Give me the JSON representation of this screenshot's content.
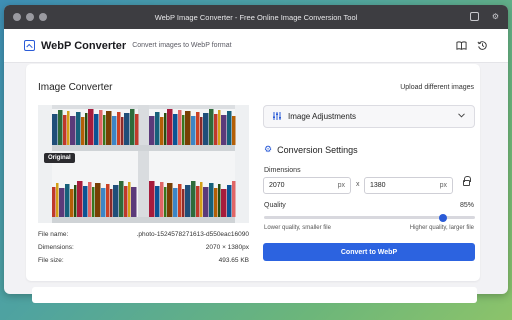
{
  "window": {
    "title": "WebP Image Converter - Free Online Image Conversion Tool"
  },
  "header": {
    "app_name": "WebP Converter",
    "tagline": "Convert images to WebP format",
    "icons": [
      "book-icon",
      "history-icon"
    ]
  },
  "converter": {
    "title": "Image Converter",
    "upload_link": "Upload different images",
    "badge": "Original",
    "file": {
      "name_label": "File name:",
      "name_value": ".photo-1524578271613-d550eac16090",
      "dims_label": "Dimensions:",
      "dims_value": "2070 × 1380px",
      "size_label": "File size:",
      "size_value": "493.65 KB"
    }
  },
  "adjustments": {
    "label": "Image Adjustments"
  },
  "settings": {
    "title": "Conversion Settings",
    "dimensions_label": "Dimensions",
    "width": "2070",
    "height": "1380",
    "unit": "px",
    "times": "x",
    "quality_label": "Quality",
    "quality_value": "85%",
    "quality": 0.85,
    "hint_low": "Lower quality, smaller file",
    "hint_high": "Higher quality, larger file",
    "convert_label": "Convert to WebP"
  },
  "colors": {
    "accent": "#2c63e0",
    "titlebar": "#3d3d41"
  }
}
